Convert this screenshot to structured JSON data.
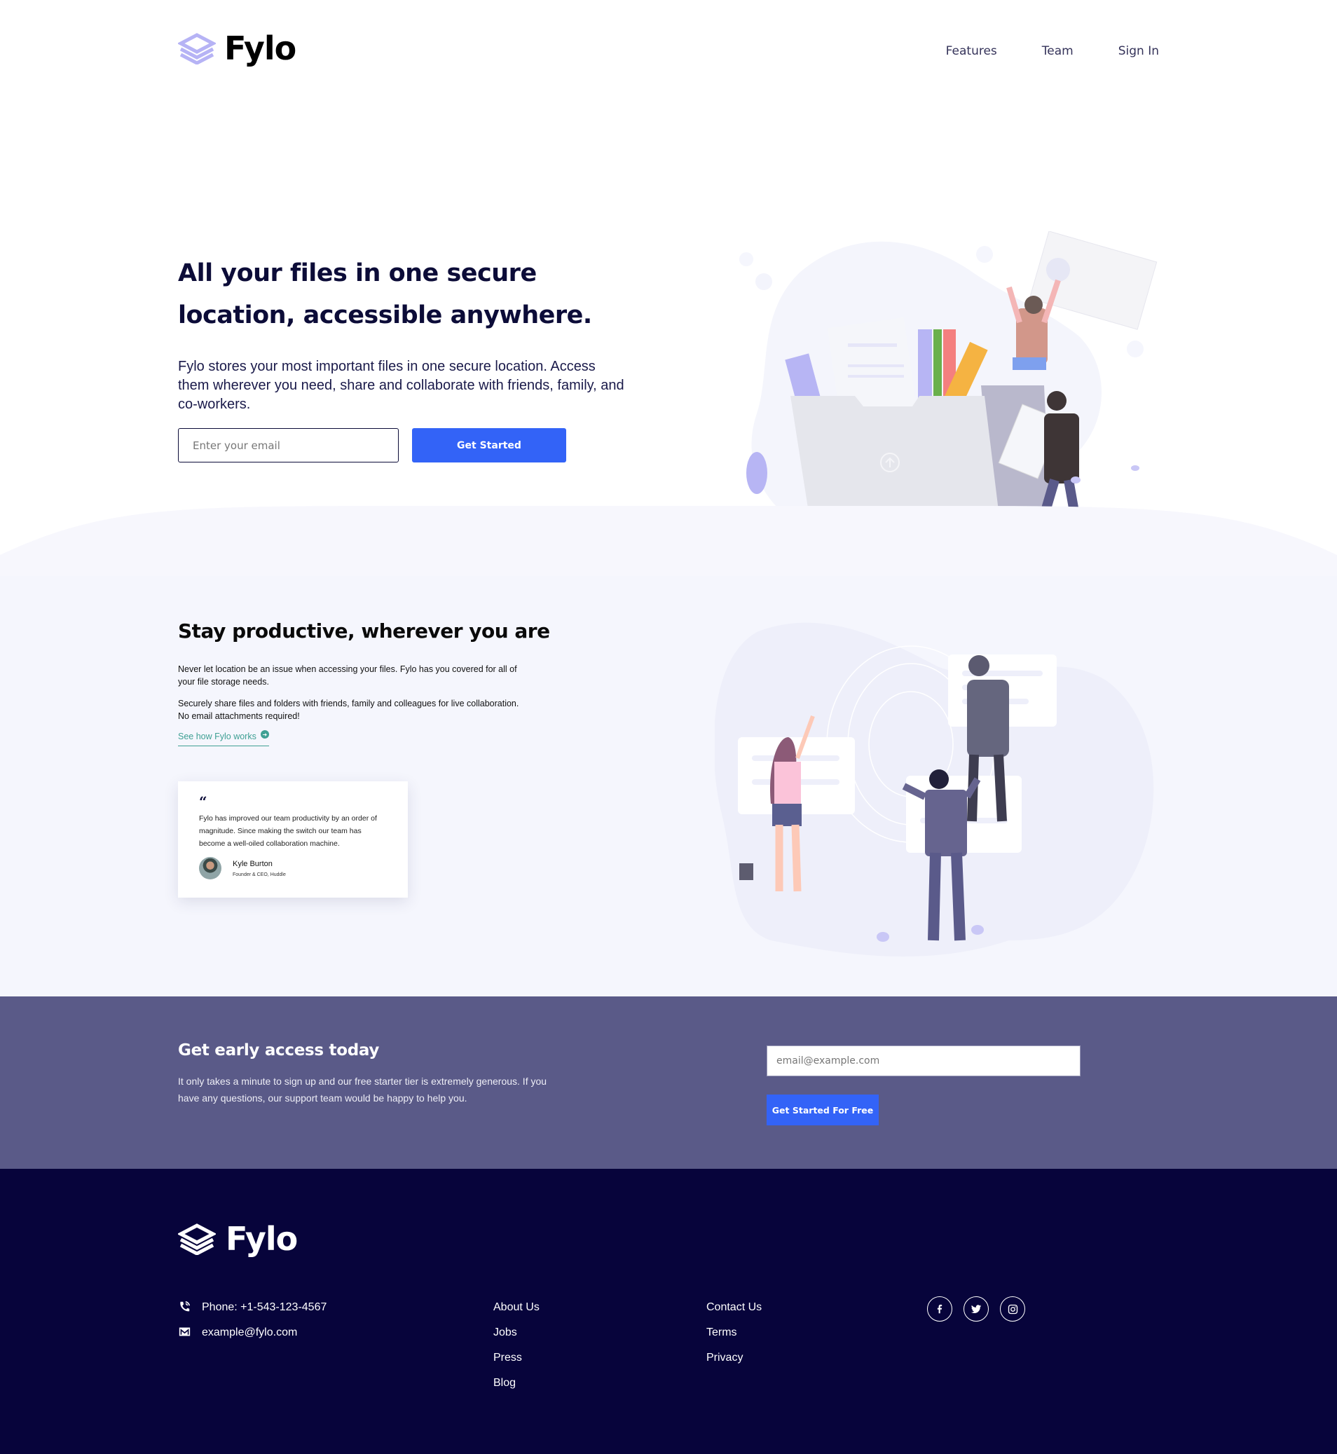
{
  "brand": {
    "name": "Fylo",
    "logo_icon": "stacked-layers-icon"
  },
  "colors": {
    "accent_blue": "#3363f7",
    "teal_link": "#3fa094",
    "navy_text": "#0c0c38",
    "early_bg": "#5a5a88",
    "footer_bg": "#07043b",
    "productive_bg": "#f5f6fd"
  },
  "nav": {
    "items": [
      {
        "label": "Features"
      },
      {
        "label": "Team"
      },
      {
        "label": "Sign In"
      }
    ]
  },
  "hero": {
    "title": "All your files in one secure location, accessible anywhere.",
    "text": "Fylo stores your most important files in one secure location. Access them wherever you need, share and collaborate with friends, family, and co-workers.",
    "email_placeholder": "Enter your email",
    "cta_label": "Get Started",
    "illustration": "people-filing-documents-illustration"
  },
  "productive": {
    "title": "Stay productive, wherever you are",
    "paragraphs": [
      "Never let location be an issue when accessing your files. Fylo has you covered for all of your file storage needs.",
      "Securely share files and folders with friends, family and colleagues for live collaboration. No email attachments required!"
    ],
    "link_label": "See how Fylo works",
    "link_icon": "arrow-circle-icon",
    "illustration": "people-holding-chat-bubbles-illustration",
    "testimonial": {
      "quote_mark": "“",
      "quote": "Fylo has improved our team productivity by an order of magnitude. Since making the switch our team has become a well-oiled collaboration machine.",
      "name": "Kyle Burton",
      "role": "Founder & CEO, Huddle"
    }
  },
  "early_access": {
    "title": "Get early access today",
    "text": "It only takes a minute to sign up and our free starter tier is extremely generous. If you have any questions, our support team would be happy to help you.",
    "email_placeholder": "email@example.com",
    "cta_label": "Get Started For Free"
  },
  "footer": {
    "phone": "Phone: +1-543-123-4567",
    "email": "example@fylo.com",
    "links_col1": [
      {
        "label": "About Us"
      },
      {
        "label": "Jobs"
      },
      {
        "label": "Press"
      },
      {
        "label": "Blog"
      }
    ],
    "links_col2": [
      {
        "label": "Contact Us"
      },
      {
        "label": "Terms"
      },
      {
        "label": "Privacy"
      }
    ],
    "social": [
      {
        "name": "facebook-icon"
      },
      {
        "name": "twitter-icon"
      },
      {
        "name": "instagram-icon"
      }
    ]
  }
}
